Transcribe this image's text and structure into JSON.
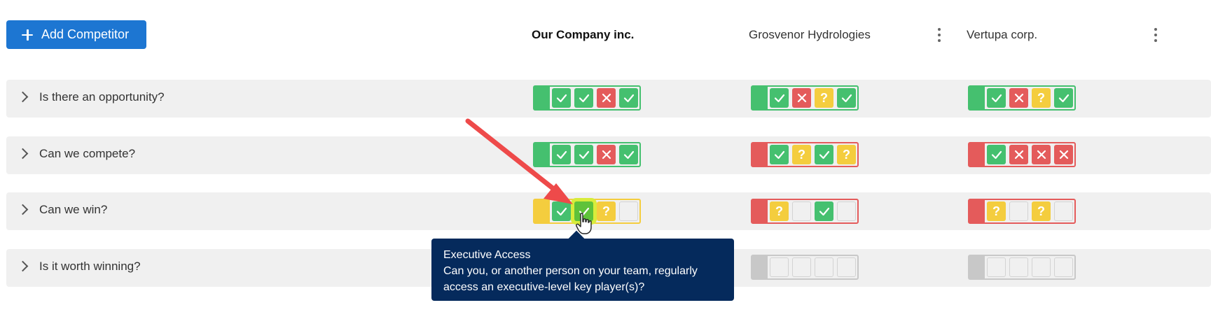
{
  "toolbar": {
    "add_label": "Add Competitor",
    "add_icon": "plus-icon"
  },
  "columns": [
    {
      "name": "Our Company inc.",
      "bold": true
    },
    {
      "name": "Grosvenor Hydrologies",
      "bold": false
    },
    {
      "name": "Vertupa corp.",
      "bold": false
    }
  ],
  "status_colors": {
    "green": "#45c06f",
    "red": "#e45b5b",
    "yellow": "#f4cd3e",
    "grey": "#c8c8c8"
  },
  "rows": [
    {
      "question": "Is there an opportunity?",
      "scores": [
        {
          "status": "green",
          "cells": [
            "check",
            "check",
            "x",
            "check"
          ]
        },
        {
          "status": "green",
          "cells": [
            "check",
            "x",
            "question",
            "check"
          ]
        },
        {
          "status": "green",
          "cells": [
            "check",
            "x",
            "question",
            "check"
          ]
        }
      ]
    },
    {
      "question": "Can we compete?",
      "scores": [
        {
          "status": "green",
          "cells": [
            "check",
            "check",
            "x",
            "check"
          ]
        },
        {
          "status": "red",
          "cells": [
            "check",
            "question",
            "check",
            "question"
          ]
        },
        {
          "status": "red",
          "cells": [
            "check",
            "x",
            "x",
            "x"
          ]
        }
      ]
    },
    {
      "question": "Can we win?",
      "scores": [
        {
          "status": "yellow",
          "cells": [
            "check",
            "check-active",
            "question",
            "empty"
          ]
        },
        {
          "status": "red",
          "cells": [
            "question",
            "empty",
            "check",
            "empty"
          ]
        },
        {
          "status": "red",
          "cells": [
            "question",
            "empty",
            "question",
            "empty"
          ]
        }
      ]
    },
    {
      "question": "Is it worth winning?",
      "scores": [
        null,
        {
          "status": "grey",
          "cells": [
            "empty",
            "empty",
            "empty",
            "empty"
          ]
        },
        {
          "status": "grey",
          "cells": [
            "empty",
            "empty",
            "empty",
            "empty"
          ]
        }
      ]
    }
  ],
  "tooltip": {
    "title": "Executive Access",
    "body_line1": "Can you, or another person on your team, regularly",
    "body_line2": "access an executive-level key player(s)?"
  },
  "glyphs": {
    "question": "?"
  }
}
